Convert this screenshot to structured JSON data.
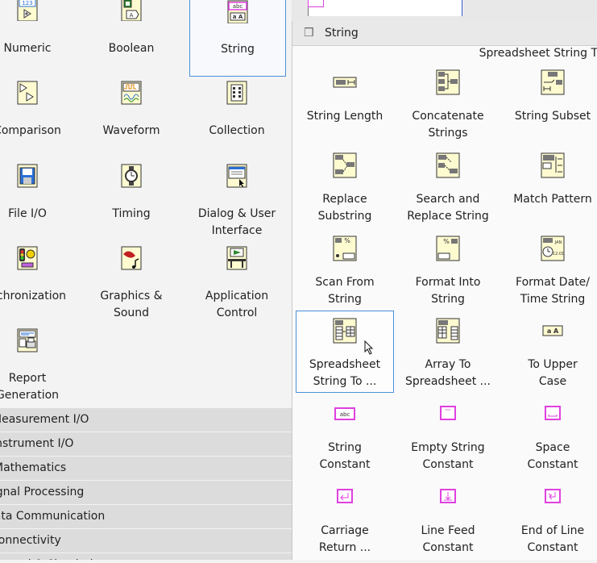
{
  "left_palette": {
    "items": [
      {
        "label": "Numeric"
      },
      {
        "label": "Boolean"
      },
      {
        "label": "String"
      },
      {
        "label": "Comparison"
      },
      {
        "label": "Waveform"
      },
      {
        "label": "Collection"
      },
      {
        "label": "File I/O"
      },
      {
        "label": "Timing"
      },
      {
        "label": "Dialog & User Interface"
      },
      {
        "label": "Synchronization"
      },
      {
        "label": "Graphics & Sound"
      },
      {
        "label": "Application Control"
      },
      {
        "label": "Report Generation"
      }
    ],
    "categories": [
      "Measurement I/O",
      "Instrument I/O",
      "Mathematics",
      "Signal Processing",
      "Data Communication",
      "Connectivity",
      "Control & Simulation"
    ],
    "icon_texts": {
      "numeric": "123",
      "string": "abc",
      "boolean": "TF"
    }
  },
  "string_palette": {
    "title": "String",
    "subheader": "Spreadsheet String T",
    "items": [
      {
        "l1": "String Length",
        "l2": ""
      },
      {
        "l1": "Concatenate",
        "l2": "Strings"
      },
      {
        "l1": "String Subset",
        "l2": ""
      },
      {
        "l1": "Replace",
        "l2": "Substring"
      },
      {
        "l1": "Search and",
        "l2": "Replace String"
      },
      {
        "l1": "Match Pattern",
        "l2": ""
      },
      {
        "l1": "Scan From",
        "l2": "String"
      },
      {
        "l1": "Format Into",
        "l2": "String"
      },
      {
        "l1": "Format Date/",
        "l2": "Time String"
      },
      {
        "l1": "Spreadsheet",
        "l2": "String To ..."
      },
      {
        "l1": "Array To",
        "l2": "Spreadsheet ..."
      },
      {
        "l1": "To Upper",
        "l2": "Case"
      },
      {
        "l1": "String",
        "l2": "Constant"
      },
      {
        "l1": "Empty String",
        "l2": "Constant"
      },
      {
        "l1": "Space",
        "l2": "Constant"
      },
      {
        "l1": "Carriage",
        "l2": "Return ..."
      },
      {
        "l1": "Line Feed",
        "l2": "Constant"
      },
      {
        "l1": "End of Line",
        "l2": "Constant"
      }
    ]
  },
  "colors": {
    "accent": "#4a90d9",
    "string_pink": "#e040e0",
    "vi_bg": "#fffbd0"
  }
}
